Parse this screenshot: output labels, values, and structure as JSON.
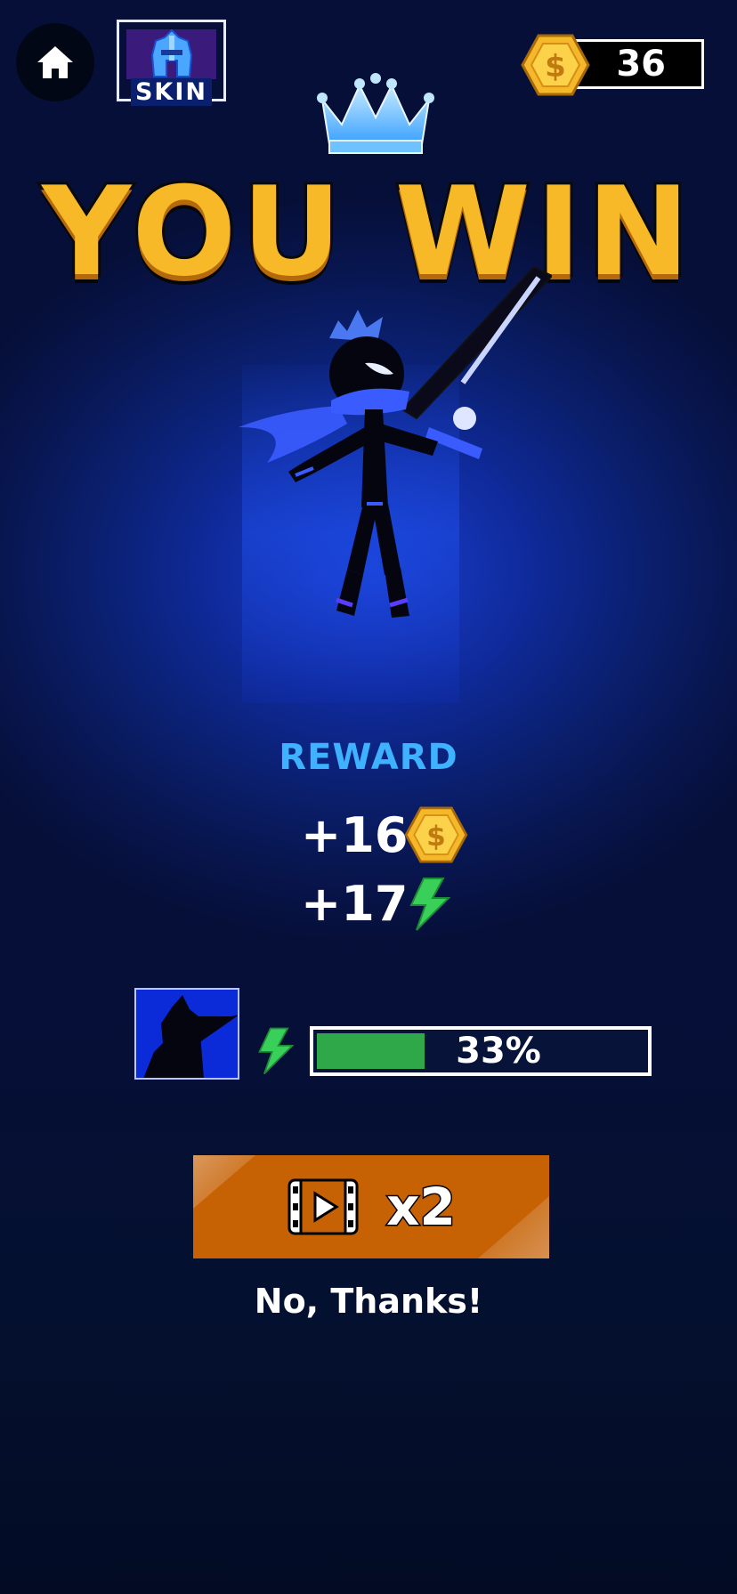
{
  "top_bar": {
    "home_icon": "home-icon",
    "skin_label": "SKIN",
    "skin_icon": "helmet-icon",
    "coins": "36",
    "coin_icon": "dollar-coin-icon"
  },
  "title": {
    "text": "YOU WIN",
    "crown_icon": "crown-icon"
  },
  "character": {
    "name": "stickman-swordsman",
    "accent": "#3a5cff"
  },
  "rewards": {
    "label": "REWARD",
    "coins": "+16",
    "energy": "+17",
    "coin_icon": "dollar-coin-icon",
    "energy_icon": "lightning-bolt-icon"
  },
  "unlock_progress": {
    "percent_label": "33%",
    "fraction": 0.33,
    "fill_color": "#2fa84a",
    "icon": "lightning-bolt-icon"
  },
  "actions": {
    "double_reward_label": "x2",
    "double_reward_icon": "video-play-icon",
    "decline_label": "No, Thanks!"
  },
  "colors": {
    "title": "#f7b928",
    "reward_label": "#3fb2ff",
    "button": "#c66104"
  }
}
